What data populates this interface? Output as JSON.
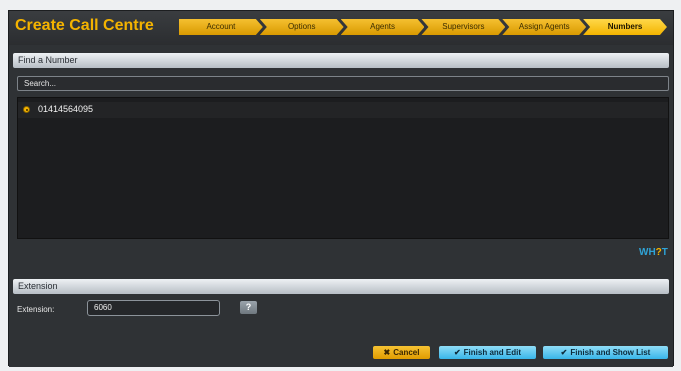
{
  "window": {
    "title": "Create Call Centre"
  },
  "steps": [
    "Account",
    "Options",
    "Agents",
    "Supervisors",
    "Assign Agents",
    "Numbers"
  ],
  "active_step": "Numbers",
  "find_panel": {
    "title": "Find a Number",
    "search_value": "Search...",
    "numbers": [
      {
        "label": "01414564095",
        "selected": true
      }
    ],
    "brand": {
      "wh": "WH",
      "q": "?",
      "t": "T"
    }
  },
  "extension_panel": {
    "title": "Extension",
    "label": "Extension:",
    "value": "6060",
    "help": "?"
  },
  "buttons": {
    "cancel": "Cancel",
    "finish_edit": "Finish and Edit",
    "finish_list": "Finish and Show List"
  },
  "colors": {
    "accent": "#f3b400",
    "action": "#38b5ea",
    "panel": "#2f3235"
  }
}
